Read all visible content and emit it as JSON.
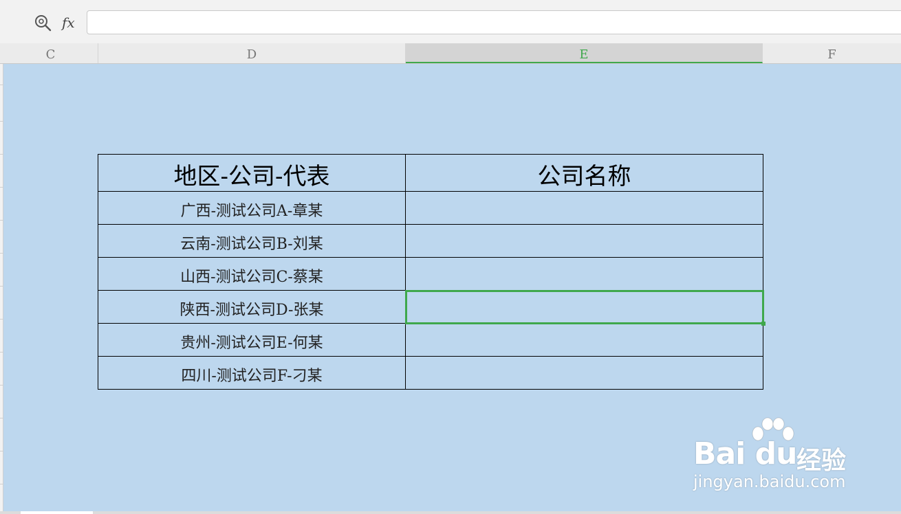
{
  "formula_bar": {
    "zoom_icon": "zoom-search-icon",
    "fx_label": "fx",
    "value": ""
  },
  "columns": [
    {
      "label": "C",
      "selected": false
    },
    {
      "label": "D",
      "selected": false
    },
    {
      "label": "E",
      "selected": true
    },
    {
      "label": "F",
      "selected": false
    }
  ],
  "table": {
    "headers": [
      "地区-公司-代表",
      "公司名称"
    ],
    "rows": [
      [
        "广西-测试公司A-章某",
        ""
      ],
      [
        "云南-测试公司B-刘某",
        ""
      ],
      [
        "山西-测试公司C-蔡某",
        ""
      ],
      [
        "陕西-测试公司D-张某",
        ""
      ],
      [
        "贵州-测试公司E-何某",
        ""
      ],
      [
        "四川-测试公司F-刁某",
        ""
      ]
    ]
  },
  "selection": {
    "column": "E",
    "row_index": 3
  },
  "colors": {
    "sheet_background": "#bdd7ee",
    "selection_accent": "#3fa84c"
  },
  "watermark": {
    "logo": "Bai du",
    "brand_cn": "经验",
    "url": "jingyan.baidu.com"
  }
}
